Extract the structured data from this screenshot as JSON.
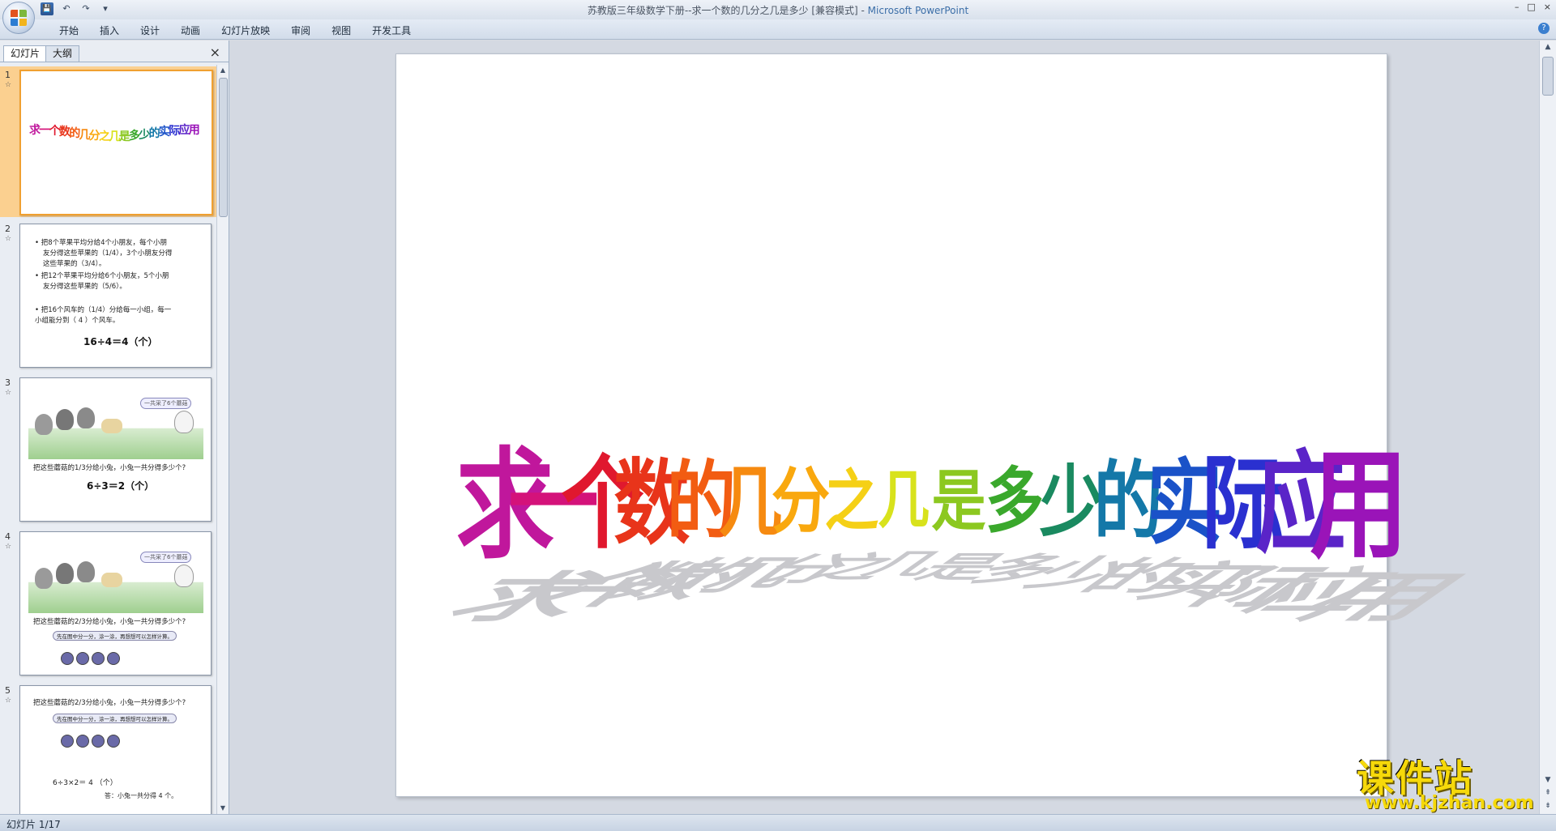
{
  "window": {
    "title_doc": "苏教版三年级数学下册--求一个数的几分之几是多少 [兼容模式]",
    "title_sep": " - ",
    "title_app": "Microsoft PowerPoint",
    "controls": [
      "–",
      "□",
      "×"
    ]
  },
  "quick_access": {
    "save": "💾",
    "undo": "↶",
    "redo": "↷",
    "customize": "▾"
  },
  "ribbon": {
    "tabs": [
      "开始",
      "插入",
      "设计",
      "动画",
      "幻灯片放映",
      "审阅",
      "视图",
      "开发工具"
    ],
    "help": "?"
  },
  "left_pane": {
    "tabs": [
      "幻灯片",
      "大纲"
    ],
    "close": "×",
    "slides": [
      {
        "num": "1",
        "star": "☆"
      },
      {
        "num": "2",
        "star": "☆"
      },
      {
        "num": "3",
        "star": "☆"
      },
      {
        "num": "4",
        "star": "☆"
      },
      {
        "num": "5",
        "star": "☆"
      }
    ],
    "thumb1_title": "求一个数的几分之几是多少的实际应用",
    "thumb2": {
      "b1a": "• 把8个苹果平均分给4个小朋友，每个小朋",
      "b1b": "友分得这些苹果的（1/4），3个小朋友分得",
      "b1c": "这些苹果的（3/4）。",
      "b2a": "• 把12个苹果平均分给6个小朋友，5个小朋",
      "b2b": "友分得这些苹果的（5/6）。",
      "b3a": "• 把16个风车的（1/4）分给每一小组，每一",
      "b3b": "小组能分到（ 4 ）个风车。",
      "eq": "16÷4＝4（个）"
    },
    "thumb3": {
      "speech": "一共采了6个蘑菇",
      "q": "把这些蘑菇的1/3分给小兔，小兔一共分得多少个?",
      "eq": "6÷3＝2（个）"
    },
    "thumb4": {
      "speech": "一共采了6个蘑菇",
      "q": "把这些蘑菇的2/3分给小兔，小兔一共分得多少个?",
      "hint": "先在图中分一分，涂一涂，再想想可以怎样计算。"
    },
    "thumb5": {
      "q": "把这些蘑菇的2/3分给小兔，小兔一共分得多少个?",
      "hint": "先在图中分一分，涂一涂，再想想可以怎样计算。",
      "eq": "6÷3×2＝ 4 （个）",
      "ans": "答：小兔一共分得 4 个。"
    }
  },
  "slide": {
    "title_chars": [
      "求",
      "一",
      "个",
      "数",
      "的",
      "几",
      "分",
      "之",
      "几",
      "是",
      "多",
      "少",
      "的",
      "实",
      "际",
      "应",
      "用"
    ],
    "colors": [
      "#c0179c",
      "#d4127a",
      "#e0182e",
      "#e8341a",
      "#f25c12",
      "#f68a10",
      "#f9a80e",
      "#f5d016",
      "#d8e21c",
      "#8cc820",
      "#3aa82c",
      "#1a8a60",
      "#1478a8",
      "#1a52c8",
      "#2a30d0",
      "#5a24c8",
      "#9a14b8"
    ]
  },
  "watermark": {
    "cn": "课件站",
    "url": "www.kjzhan.com"
  },
  "status": {
    "slide_info": "幻灯片 1/17"
  }
}
